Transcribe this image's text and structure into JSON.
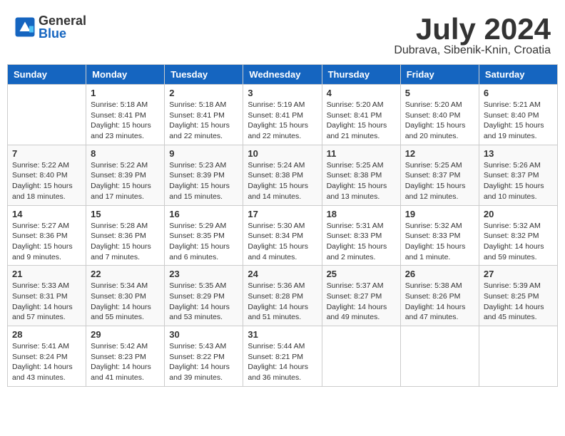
{
  "header": {
    "logo_general": "General",
    "logo_blue": "Blue",
    "month": "July 2024",
    "location": "Dubrava, Sibenik-Knin, Croatia"
  },
  "days_of_week": [
    "Sunday",
    "Monday",
    "Tuesday",
    "Wednesday",
    "Thursday",
    "Friday",
    "Saturday"
  ],
  "weeks": [
    [
      {
        "day": "",
        "info": ""
      },
      {
        "day": "1",
        "info": "Sunrise: 5:18 AM\nSunset: 8:41 PM\nDaylight: 15 hours\nand 23 minutes."
      },
      {
        "day": "2",
        "info": "Sunrise: 5:18 AM\nSunset: 8:41 PM\nDaylight: 15 hours\nand 22 minutes."
      },
      {
        "day": "3",
        "info": "Sunrise: 5:19 AM\nSunset: 8:41 PM\nDaylight: 15 hours\nand 22 minutes."
      },
      {
        "day": "4",
        "info": "Sunrise: 5:20 AM\nSunset: 8:41 PM\nDaylight: 15 hours\nand 21 minutes."
      },
      {
        "day": "5",
        "info": "Sunrise: 5:20 AM\nSunset: 8:40 PM\nDaylight: 15 hours\nand 20 minutes."
      },
      {
        "day": "6",
        "info": "Sunrise: 5:21 AM\nSunset: 8:40 PM\nDaylight: 15 hours\nand 19 minutes."
      }
    ],
    [
      {
        "day": "7",
        "info": "Sunrise: 5:22 AM\nSunset: 8:40 PM\nDaylight: 15 hours\nand 18 minutes."
      },
      {
        "day": "8",
        "info": "Sunrise: 5:22 AM\nSunset: 8:39 PM\nDaylight: 15 hours\nand 17 minutes."
      },
      {
        "day": "9",
        "info": "Sunrise: 5:23 AM\nSunset: 8:39 PM\nDaylight: 15 hours\nand 15 minutes."
      },
      {
        "day": "10",
        "info": "Sunrise: 5:24 AM\nSunset: 8:38 PM\nDaylight: 15 hours\nand 14 minutes."
      },
      {
        "day": "11",
        "info": "Sunrise: 5:25 AM\nSunset: 8:38 PM\nDaylight: 15 hours\nand 13 minutes."
      },
      {
        "day": "12",
        "info": "Sunrise: 5:25 AM\nSunset: 8:37 PM\nDaylight: 15 hours\nand 12 minutes."
      },
      {
        "day": "13",
        "info": "Sunrise: 5:26 AM\nSunset: 8:37 PM\nDaylight: 15 hours\nand 10 minutes."
      }
    ],
    [
      {
        "day": "14",
        "info": "Sunrise: 5:27 AM\nSunset: 8:36 PM\nDaylight: 15 hours\nand 9 minutes."
      },
      {
        "day": "15",
        "info": "Sunrise: 5:28 AM\nSunset: 8:36 PM\nDaylight: 15 hours\nand 7 minutes."
      },
      {
        "day": "16",
        "info": "Sunrise: 5:29 AM\nSunset: 8:35 PM\nDaylight: 15 hours\nand 6 minutes."
      },
      {
        "day": "17",
        "info": "Sunrise: 5:30 AM\nSunset: 8:34 PM\nDaylight: 15 hours\nand 4 minutes."
      },
      {
        "day": "18",
        "info": "Sunrise: 5:31 AM\nSunset: 8:33 PM\nDaylight: 15 hours\nand 2 minutes."
      },
      {
        "day": "19",
        "info": "Sunrise: 5:32 AM\nSunset: 8:33 PM\nDaylight: 15 hours\nand 1 minute."
      },
      {
        "day": "20",
        "info": "Sunrise: 5:32 AM\nSunset: 8:32 PM\nDaylight: 14 hours\nand 59 minutes."
      }
    ],
    [
      {
        "day": "21",
        "info": "Sunrise: 5:33 AM\nSunset: 8:31 PM\nDaylight: 14 hours\nand 57 minutes."
      },
      {
        "day": "22",
        "info": "Sunrise: 5:34 AM\nSunset: 8:30 PM\nDaylight: 14 hours\nand 55 minutes."
      },
      {
        "day": "23",
        "info": "Sunrise: 5:35 AM\nSunset: 8:29 PM\nDaylight: 14 hours\nand 53 minutes."
      },
      {
        "day": "24",
        "info": "Sunrise: 5:36 AM\nSunset: 8:28 PM\nDaylight: 14 hours\nand 51 minutes."
      },
      {
        "day": "25",
        "info": "Sunrise: 5:37 AM\nSunset: 8:27 PM\nDaylight: 14 hours\nand 49 minutes."
      },
      {
        "day": "26",
        "info": "Sunrise: 5:38 AM\nSunset: 8:26 PM\nDaylight: 14 hours\nand 47 minutes."
      },
      {
        "day": "27",
        "info": "Sunrise: 5:39 AM\nSunset: 8:25 PM\nDaylight: 14 hours\nand 45 minutes."
      }
    ],
    [
      {
        "day": "28",
        "info": "Sunrise: 5:41 AM\nSunset: 8:24 PM\nDaylight: 14 hours\nand 43 minutes."
      },
      {
        "day": "29",
        "info": "Sunrise: 5:42 AM\nSunset: 8:23 PM\nDaylight: 14 hours\nand 41 minutes."
      },
      {
        "day": "30",
        "info": "Sunrise: 5:43 AM\nSunset: 8:22 PM\nDaylight: 14 hours\nand 39 minutes."
      },
      {
        "day": "31",
        "info": "Sunrise: 5:44 AM\nSunset: 8:21 PM\nDaylight: 14 hours\nand 36 minutes."
      },
      {
        "day": "",
        "info": ""
      },
      {
        "day": "",
        "info": ""
      },
      {
        "day": "",
        "info": ""
      }
    ]
  ]
}
